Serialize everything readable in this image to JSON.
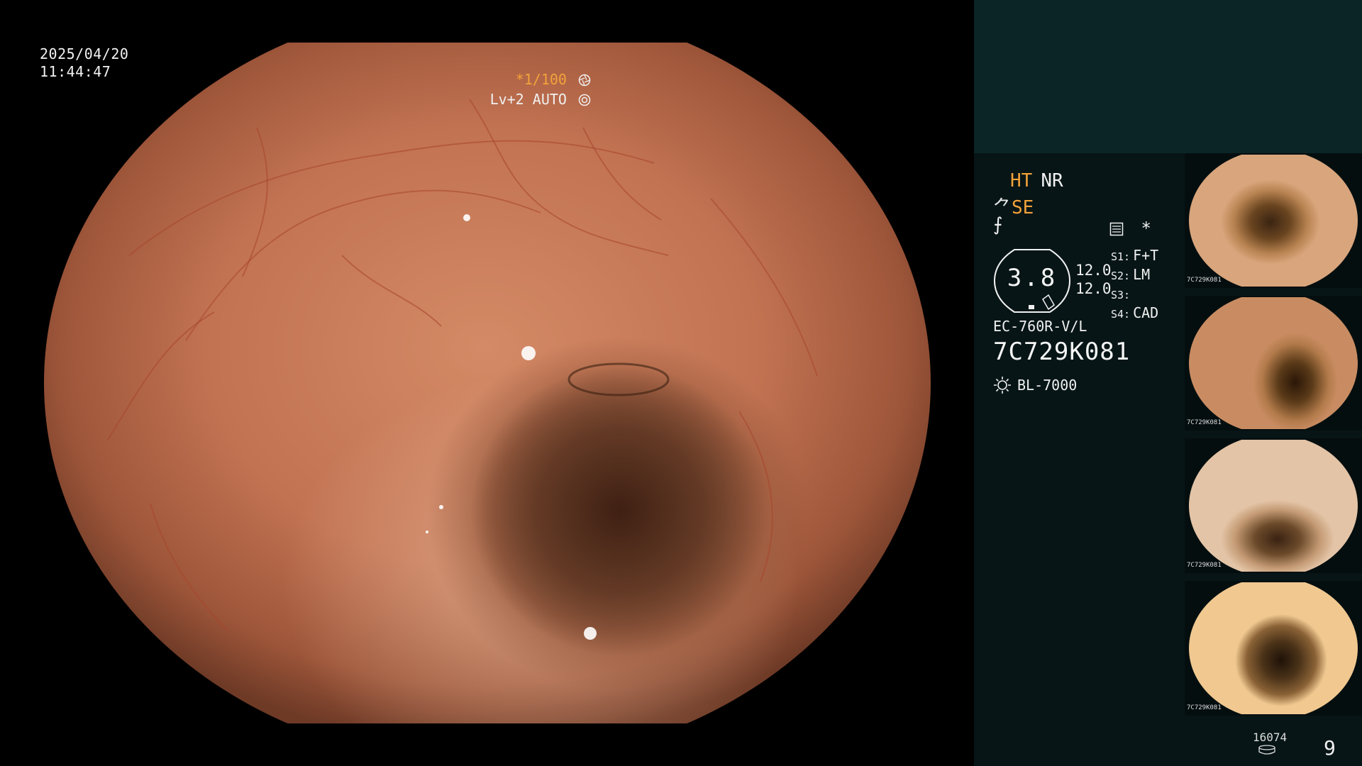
{
  "main_view": {
    "date": "2025/04/20",
    "time": "11:44:47",
    "shutter": "*1/100",
    "shutter_icon": "aperture-icon",
    "level": "Lv+2",
    "iris_mode": "AUTO",
    "iris_icon": "iris-icon"
  },
  "panel": {
    "ht": "HT",
    "nr": "NR",
    "se_prefix": "⺈",
    "se": "SE",
    "f_symbol": "⨍",
    "icons_right": [
      "memory-icon",
      "asterisk-icon"
    ],
    "asterisk": "*",
    "badge_value": "3.8",
    "level_1": "12.0",
    "level_2": "12.0",
    "switches": [
      {
        "key": "S1:",
        "value": "F+T"
      },
      {
        "key": "S2:",
        "value": "LM"
      },
      {
        "key": "S3:",
        "value": ""
      },
      {
        "key": "S4:",
        "value": "CAD"
      }
    ],
    "scope_model": "EC-760R-V/L",
    "scope_serial": "7C729K081",
    "light_source": "BL-7000",
    "light_icon": "sun-icon"
  },
  "thumbnails": [
    {
      "label": "7C729K081"
    },
    {
      "label": "7C729K081"
    },
    {
      "label": "7C729K081"
    },
    {
      "label": "7C729K081"
    }
  ],
  "footer": {
    "counter": "16074",
    "counter_icon": "storage-icon",
    "page": "9"
  },
  "colors": {
    "accent_orange": "#f2a23a",
    "panel_top": "#0b2526",
    "panel_bottom": "#071516"
  }
}
